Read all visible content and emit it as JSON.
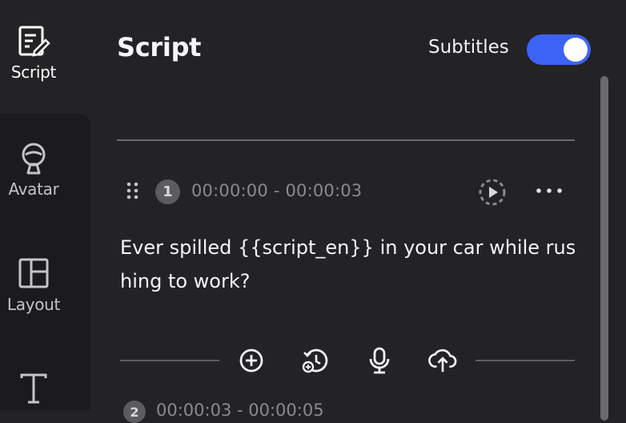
{
  "sidebar": {
    "items": [
      {
        "label": "Script",
        "icon": "script-edit-icon"
      },
      {
        "label": "Avatar",
        "icon": "avatar-icon"
      },
      {
        "label": "Layout",
        "icon": "layout-icon"
      },
      {
        "label": "",
        "icon": "text-icon"
      }
    ]
  },
  "header": {
    "title": "Script",
    "subtitles_label": "Subtitles",
    "subtitles_enabled": true
  },
  "scenes": [
    {
      "number": "1",
      "time_range": "00:00:00 - 00:00:03",
      "text": "Ever spilled {{script_en}} in your car while rushing to work?"
    },
    {
      "number": "2",
      "time_range": "00:00:03 - 00:00:05"
    }
  ],
  "actions": [
    {
      "icon": "add-circle-icon"
    },
    {
      "icon": "history-add-icon"
    },
    {
      "icon": "microphone-icon"
    },
    {
      "icon": "cloud-upload-icon"
    }
  ],
  "colors": {
    "accent": "#3c63f5",
    "background": "#232325",
    "sidebar_panel": "#1b1b1d",
    "muted_text": "#8a8a8f"
  }
}
